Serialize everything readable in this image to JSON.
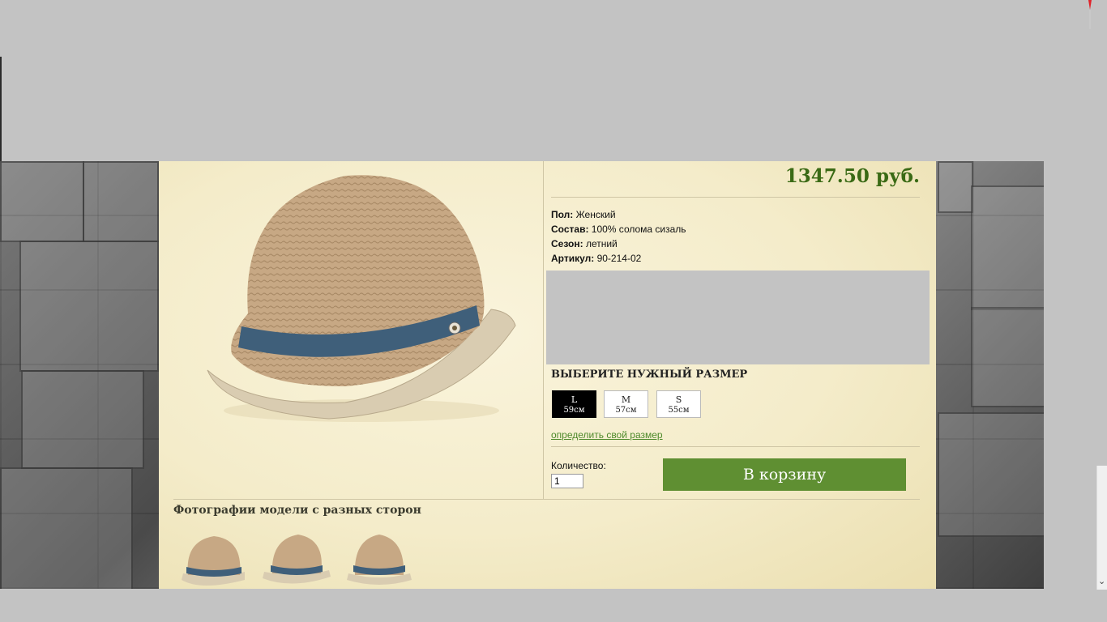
{
  "product": {
    "price": "1347.50 руб.",
    "properties": [
      {
        "label": "Пол:",
        "value": "Женский"
      },
      {
        "label": "Состав:",
        "value": "100% солома сизаль"
      },
      {
        "label": "Сезон:",
        "value": "летний"
      },
      {
        "label": "Артикул:",
        "value": "90-214-02"
      }
    ]
  },
  "size": {
    "title": "ВЫБЕРИТЕ НУЖНЫЙ РАЗМЕР",
    "options": [
      {
        "letter": "L",
        "cm": "59см",
        "selected": true
      },
      {
        "letter": "M",
        "cm": "57см",
        "selected": false
      },
      {
        "letter": "S",
        "cm": "55см",
        "selected": false
      }
    ],
    "help_link": "определить свой размер"
  },
  "quantity": {
    "label": "Количество:",
    "value": "1"
  },
  "cart": {
    "button_label": "В корзину"
  },
  "photos": {
    "title": "Фотографии модели с разных сторон"
  },
  "colors": {
    "accent": "#5f8f32",
    "price": "#3a6a15",
    "panel": "#f4ecca"
  }
}
